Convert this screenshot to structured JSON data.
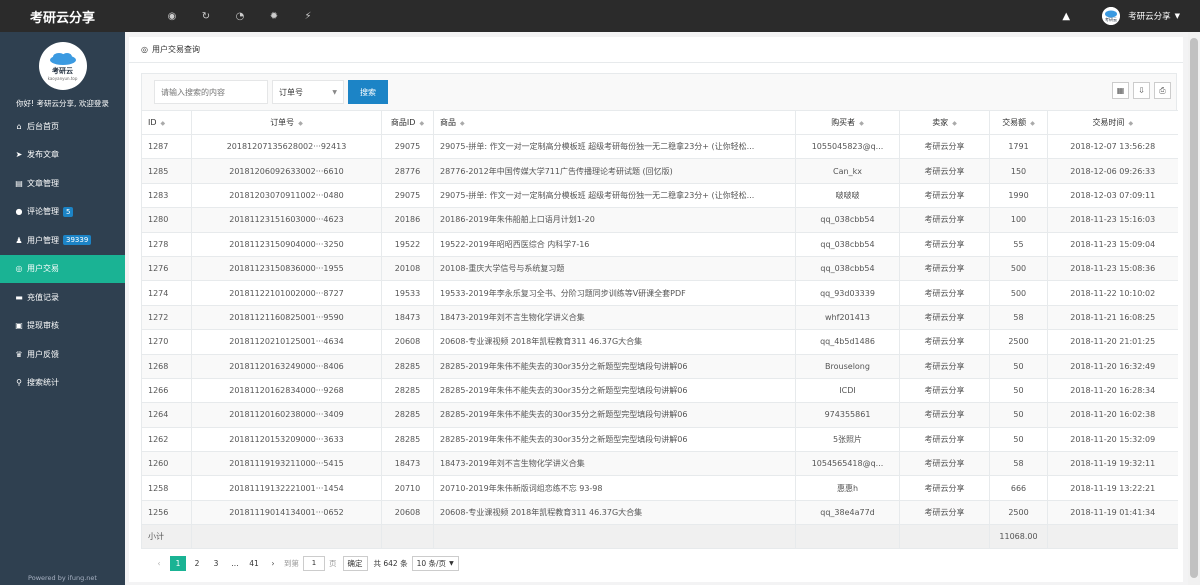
{
  "app": {
    "brand": "考研云分享",
    "user_name": "考研云分享"
  },
  "sidebar": {
    "welcome": "你好! 考研云分享, 欢迎登录",
    "logo_text": "考研云",
    "logo_sub": "kaoyanyun.top",
    "powered": "Powered by ifung.net",
    "items": [
      {
        "label": "后台首页",
        "icon": "home-icon"
      },
      {
        "label": "发布文章",
        "icon": "send-icon"
      },
      {
        "label": "文章管理",
        "icon": "book-icon"
      },
      {
        "label": "评论管理",
        "icon": "comment-icon",
        "badge": "5"
      },
      {
        "label": "用户管理",
        "icon": "users-icon",
        "badge": "39339"
      },
      {
        "label": "用户交易",
        "icon": "eye-icon"
      },
      {
        "label": "充值记录",
        "icon": "card-icon"
      },
      {
        "label": "提现审核",
        "icon": "money-icon"
      },
      {
        "label": "用户反馈",
        "icon": "feedback-icon"
      },
      {
        "label": "搜索统计",
        "icon": "search-icon"
      }
    ]
  },
  "main": {
    "title": "用户交易查询",
    "search": {
      "placeholder": "请输入搜索的内容",
      "field": "订单号",
      "button": "搜索"
    },
    "columns": [
      "ID",
      "订单号",
      "商品ID",
      "商品",
      "购买者",
      "卖家",
      "交易额",
      "交易时间"
    ],
    "rows": [
      [
        "1287",
        "20181207135628002···92413",
        "29075",
        "29075-拼单: 作文一对一定制高分模板班 超级考研每份独一无二稳拿23分+ (让你轻松...",
        "1055045823@q...",
        "考研云分享",
        "1791",
        "2018-12-07 13:56:28"
      ],
      [
        "1285",
        "20181206092633002···6610",
        "28776",
        "28776-2012年中国传媒大学711广告传播理论考研试题 (回忆版)",
        "Can_kx",
        "考研云分享",
        "150",
        "2018-12-06 09:26:33"
      ],
      [
        "1283",
        "20181203070911002···0480",
        "29075",
        "29075-拼单: 作文一对一定制高分模板班 超级考研每份独一无二稳拿23分+ (让你轻松...",
        "啵啵啵",
        "考研云分享",
        "1990",
        "2018-12-03 07:09:11"
      ],
      [
        "1280",
        "20181123151603000···4623",
        "20186",
        "20186-2019年朱伟船舶上口语月计划1-20",
        "qq_038cbb54",
        "考研云分享",
        "100",
        "2018-11-23 15:16:03"
      ],
      [
        "1278",
        "20181123150904000···3250",
        "19522",
        "19522-2019年昭昭西医综合 内科学7-16",
        "qq_038cbb54",
        "考研云分享",
        "55",
        "2018-11-23 15:09:04"
      ],
      [
        "1276",
        "20181123150836000···1955",
        "20108",
        "20108-重庆大学信号与系统复习题",
        "qq_038cbb54",
        "考研云分享",
        "500",
        "2018-11-23 15:08:36"
      ],
      [
        "1274",
        "20181122101002000···8727",
        "19533",
        "19533-2019年李永乐复习全书、分阶习题同步训练等V研课全套PDF",
        "qq_93d03339",
        "考研云分享",
        "500",
        "2018-11-22 10:10:02"
      ],
      [
        "1272",
        "20181121160825001···9590",
        "18473",
        "18473-2019年刘不言生物化学讲义合集",
        "whf201413",
        "考研云分享",
        "58",
        "2018-11-21 16:08:25"
      ],
      [
        "1270",
        "20181120210125001···4634",
        "20608",
        "20608-专业课视频 2018年凯程教育311 46.37G大合集",
        "qq_4b5d1486",
        "考研云分享",
        "2500",
        "2018-11-20 21:01:25"
      ],
      [
        "1268",
        "20181120163249000···8406",
        "28285",
        "28285-2019年朱伟不能失去的30or35分之新题型完型填段句讲解06",
        "Brouselong",
        "考研云分享",
        "50",
        "2018-11-20 16:32:49"
      ],
      [
        "1266",
        "20181120162834000···9268",
        "28285",
        "28285-2019年朱伟不能失去的30or35分之新题型完型填段句讲解06",
        "ICDI",
        "考研云分享",
        "50",
        "2018-11-20 16:28:34"
      ],
      [
        "1264",
        "20181120160238000···3409",
        "28285",
        "28285-2019年朱伟不能失去的30or35分之新题型完型填段句讲解06",
        "974355861",
        "考研云分享",
        "50",
        "2018-11-20 16:02:38"
      ],
      [
        "1262",
        "20181120153209000···3633",
        "28285",
        "28285-2019年朱伟不能失去的30or35分之新题型完型填段句讲解06",
        "5张照片",
        "考研云分享",
        "50",
        "2018-11-20 15:32:09"
      ],
      [
        "1260",
        "20181119193211000···5415",
        "18473",
        "18473-2019年刘不言生物化学讲义合集",
        "1054565418@q...",
        "考研云分享",
        "58",
        "2018-11-19 19:32:11"
      ],
      [
        "1258",
        "20181119132221001···1454",
        "20710",
        "20710-2019年朱伟新版词组恋练不忘 93-98",
        "惠惠h",
        "考研云分享",
        "666",
        "2018-11-19 13:22:21"
      ],
      [
        "1256",
        "20181119014134001···0652",
        "20608",
        "20608-专业课视频 2018年凯程教育311 46.37G大合集",
        "qq_38e4a77d",
        "考研云分享",
        "2500",
        "2018-11-19 01:41:34"
      ]
    ],
    "footer": {
      "label": "小计",
      "total": "11068.00"
    },
    "pager": {
      "pages": [
        "1",
        "2",
        "3",
        "...",
        "41"
      ],
      "goto": "到第",
      "page_value": "1",
      "page_unit": "页",
      "confirm": "确定",
      "total": "共 642 条",
      "per_page": "10 条/页"
    }
  }
}
